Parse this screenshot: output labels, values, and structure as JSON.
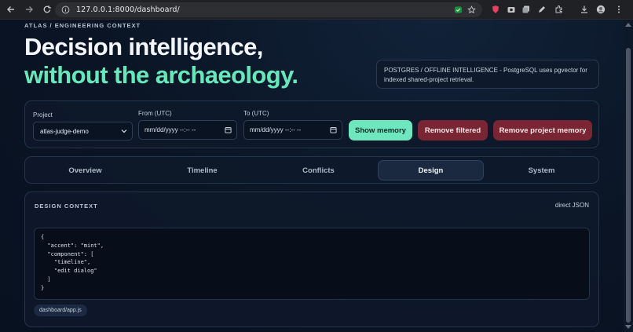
{
  "browser": {
    "url": "127.0.0.1:8000/dashboard/"
  },
  "header": {
    "eyebrow": "ATLAS / ENGINEERING CONTEXT",
    "title_line1": "Decision intelligence,",
    "title_line2": "without the archaeology.",
    "note": "POSTGRES / OFFLINE INTELLIGENCE - PostgreSQL uses pgvector for indexed shared-project retrieval."
  },
  "filters": {
    "project_label": "Project",
    "project_value": "atlas-judge-demo",
    "from_label": "From (UTC)",
    "from_placeholder": "mm/dd/yyyy --:-- --",
    "to_label": "To (UTC)",
    "to_placeholder": "mm/dd/yyyy --:-- --",
    "show_memory": "Show memory",
    "remove_filtered": "Remove filtered",
    "remove_project_memory": "Remove project memory"
  },
  "tabs": [
    {
      "label": "Overview",
      "active": false
    },
    {
      "label": "Timeline",
      "active": false
    },
    {
      "label": "Conflicts",
      "active": false
    },
    {
      "label": "Design",
      "active": true
    },
    {
      "label": "System",
      "active": false
    }
  ],
  "design_context": {
    "title": "DESIGN CONTEXT",
    "meta": "direct JSON",
    "code_lines": [
      "{",
      "  \"accent\": \"mint\",",
      "  \"component\": [",
      "    \"timeline\",",
      "    \"edit dialog\"",
      "  ]",
      "}"
    ],
    "source_chip": "dashboard/app.js"
  },
  "colors": {
    "background": "#0b1526",
    "accent_mint": "#67e8bb",
    "danger": "#7a2533"
  }
}
